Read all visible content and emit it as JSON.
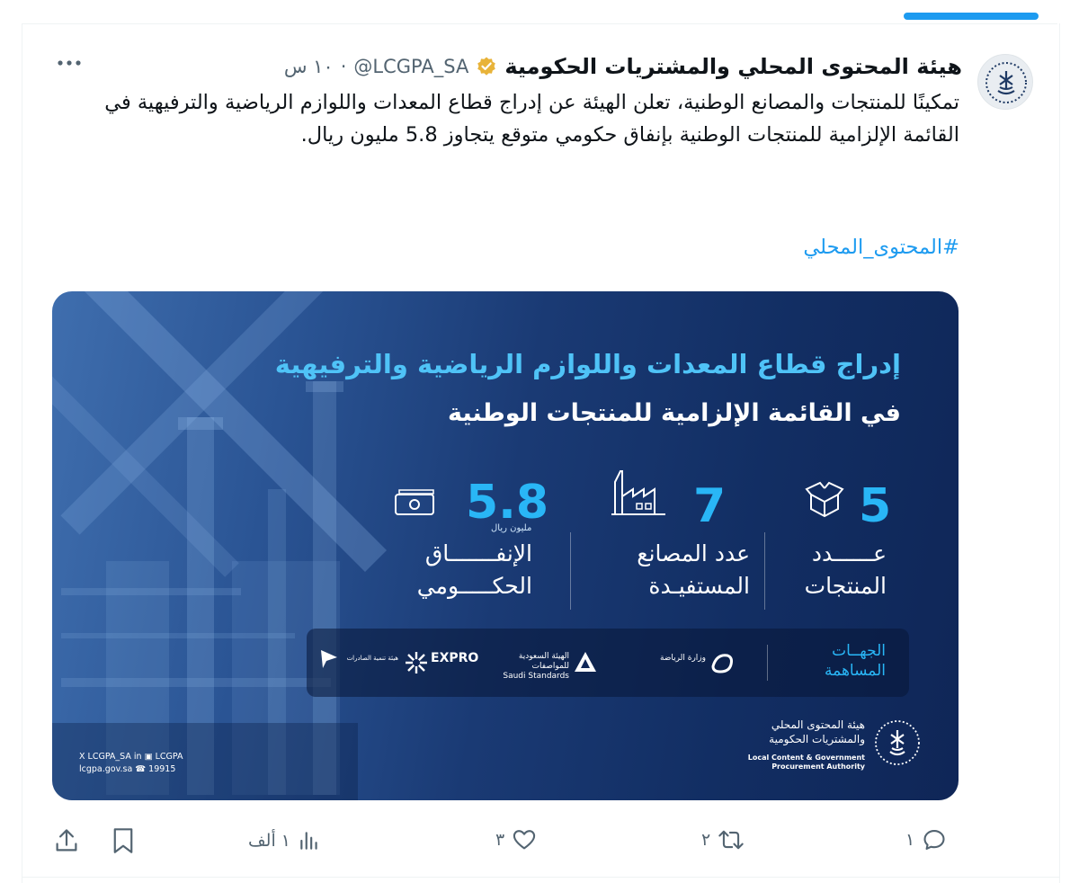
{
  "account": {
    "display_name": "هيئة المحتوى المحلي والمشتريات الحكومية",
    "handle": "@LCGPA_SA",
    "separator": "·",
    "time": "١٠ س"
  },
  "tweet": {
    "text": "تمكينًا للمنتجات والمصانع الوطنية، تعلن الهيئة عن إدراج قطاع المعدات واللوازم الرياضية والترفيهية في القائمة الإلزامية للمنتجات الوطنية بإنفاق حكومي متوقع يتجاوز 5.8 مليون ريال.",
    "hashtag": "#المحتوى_المحلي"
  },
  "card": {
    "title_line1": "إدراج قطاع المعدات واللوازم الرياضية والترفيهية",
    "title_line2": "في القائمة الإلزامية للمنتجات الوطنية",
    "stats": [
      {
        "number": "5",
        "label_line1": "عــــــدد",
        "label_line2": "المنتجات",
        "icon": "box-icon"
      },
      {
        "number": "7",
        "label_line1": "عدد المصانع",
        "label_line2": "المستفيـدة",
        "icon": "factory-icon"
      },
      {
        "number": "5.8",
        "unit": "مليون ريال",
        "label_line1": "الإنفـــــــاق",
        "label_line2": "الحكـــــومي",
        "icon": "money-icon"
      }
    ],
    "partners_label_line1": "الجهــات",
    "partners_label_line2": "المساهمة",
    "partners": [
      {
        "name": "وزارة الرياضة",
        "icon": "sports-ministry-logo"
      },
      {
        "name": "الهيئة السعودية للمواصفات",
        "sub": "Saudi Standards",
        "icon": "saso-logo"
      },
      {
        "name": "EXPRO",
        "icon": "expro-logo"
      },
      {
        "name": "هيئة تنمية الصادرات",
        "icon": "export-authority-logo"
      }
    ],
    "org_ar_line1": "هيئة المحتوى المحلي",
    "org_ar_line2": "والمشتريات الحكومية",
    "org_en_line1": "Local Content & Government",
    "org_en_line2": "Procurement Authority",
    "contact_line1": "X LCGPA_SA   in ▣ LCGPA",
    "contact_line2": "lcgpa.gov.sa    ☎ 19915"
  },
  "actions": {
    "replies": "١",
    "reposts": "٢",
    "likes": "٣",
    "views": "١ ألف"
  },
  "colors": {
    "accent": "#1d9bf0",
    "card_cyan": "#29b6f6",
    "card_navy": "#0f2657",
    "verified_gold": "#e8b339"
  }
}
